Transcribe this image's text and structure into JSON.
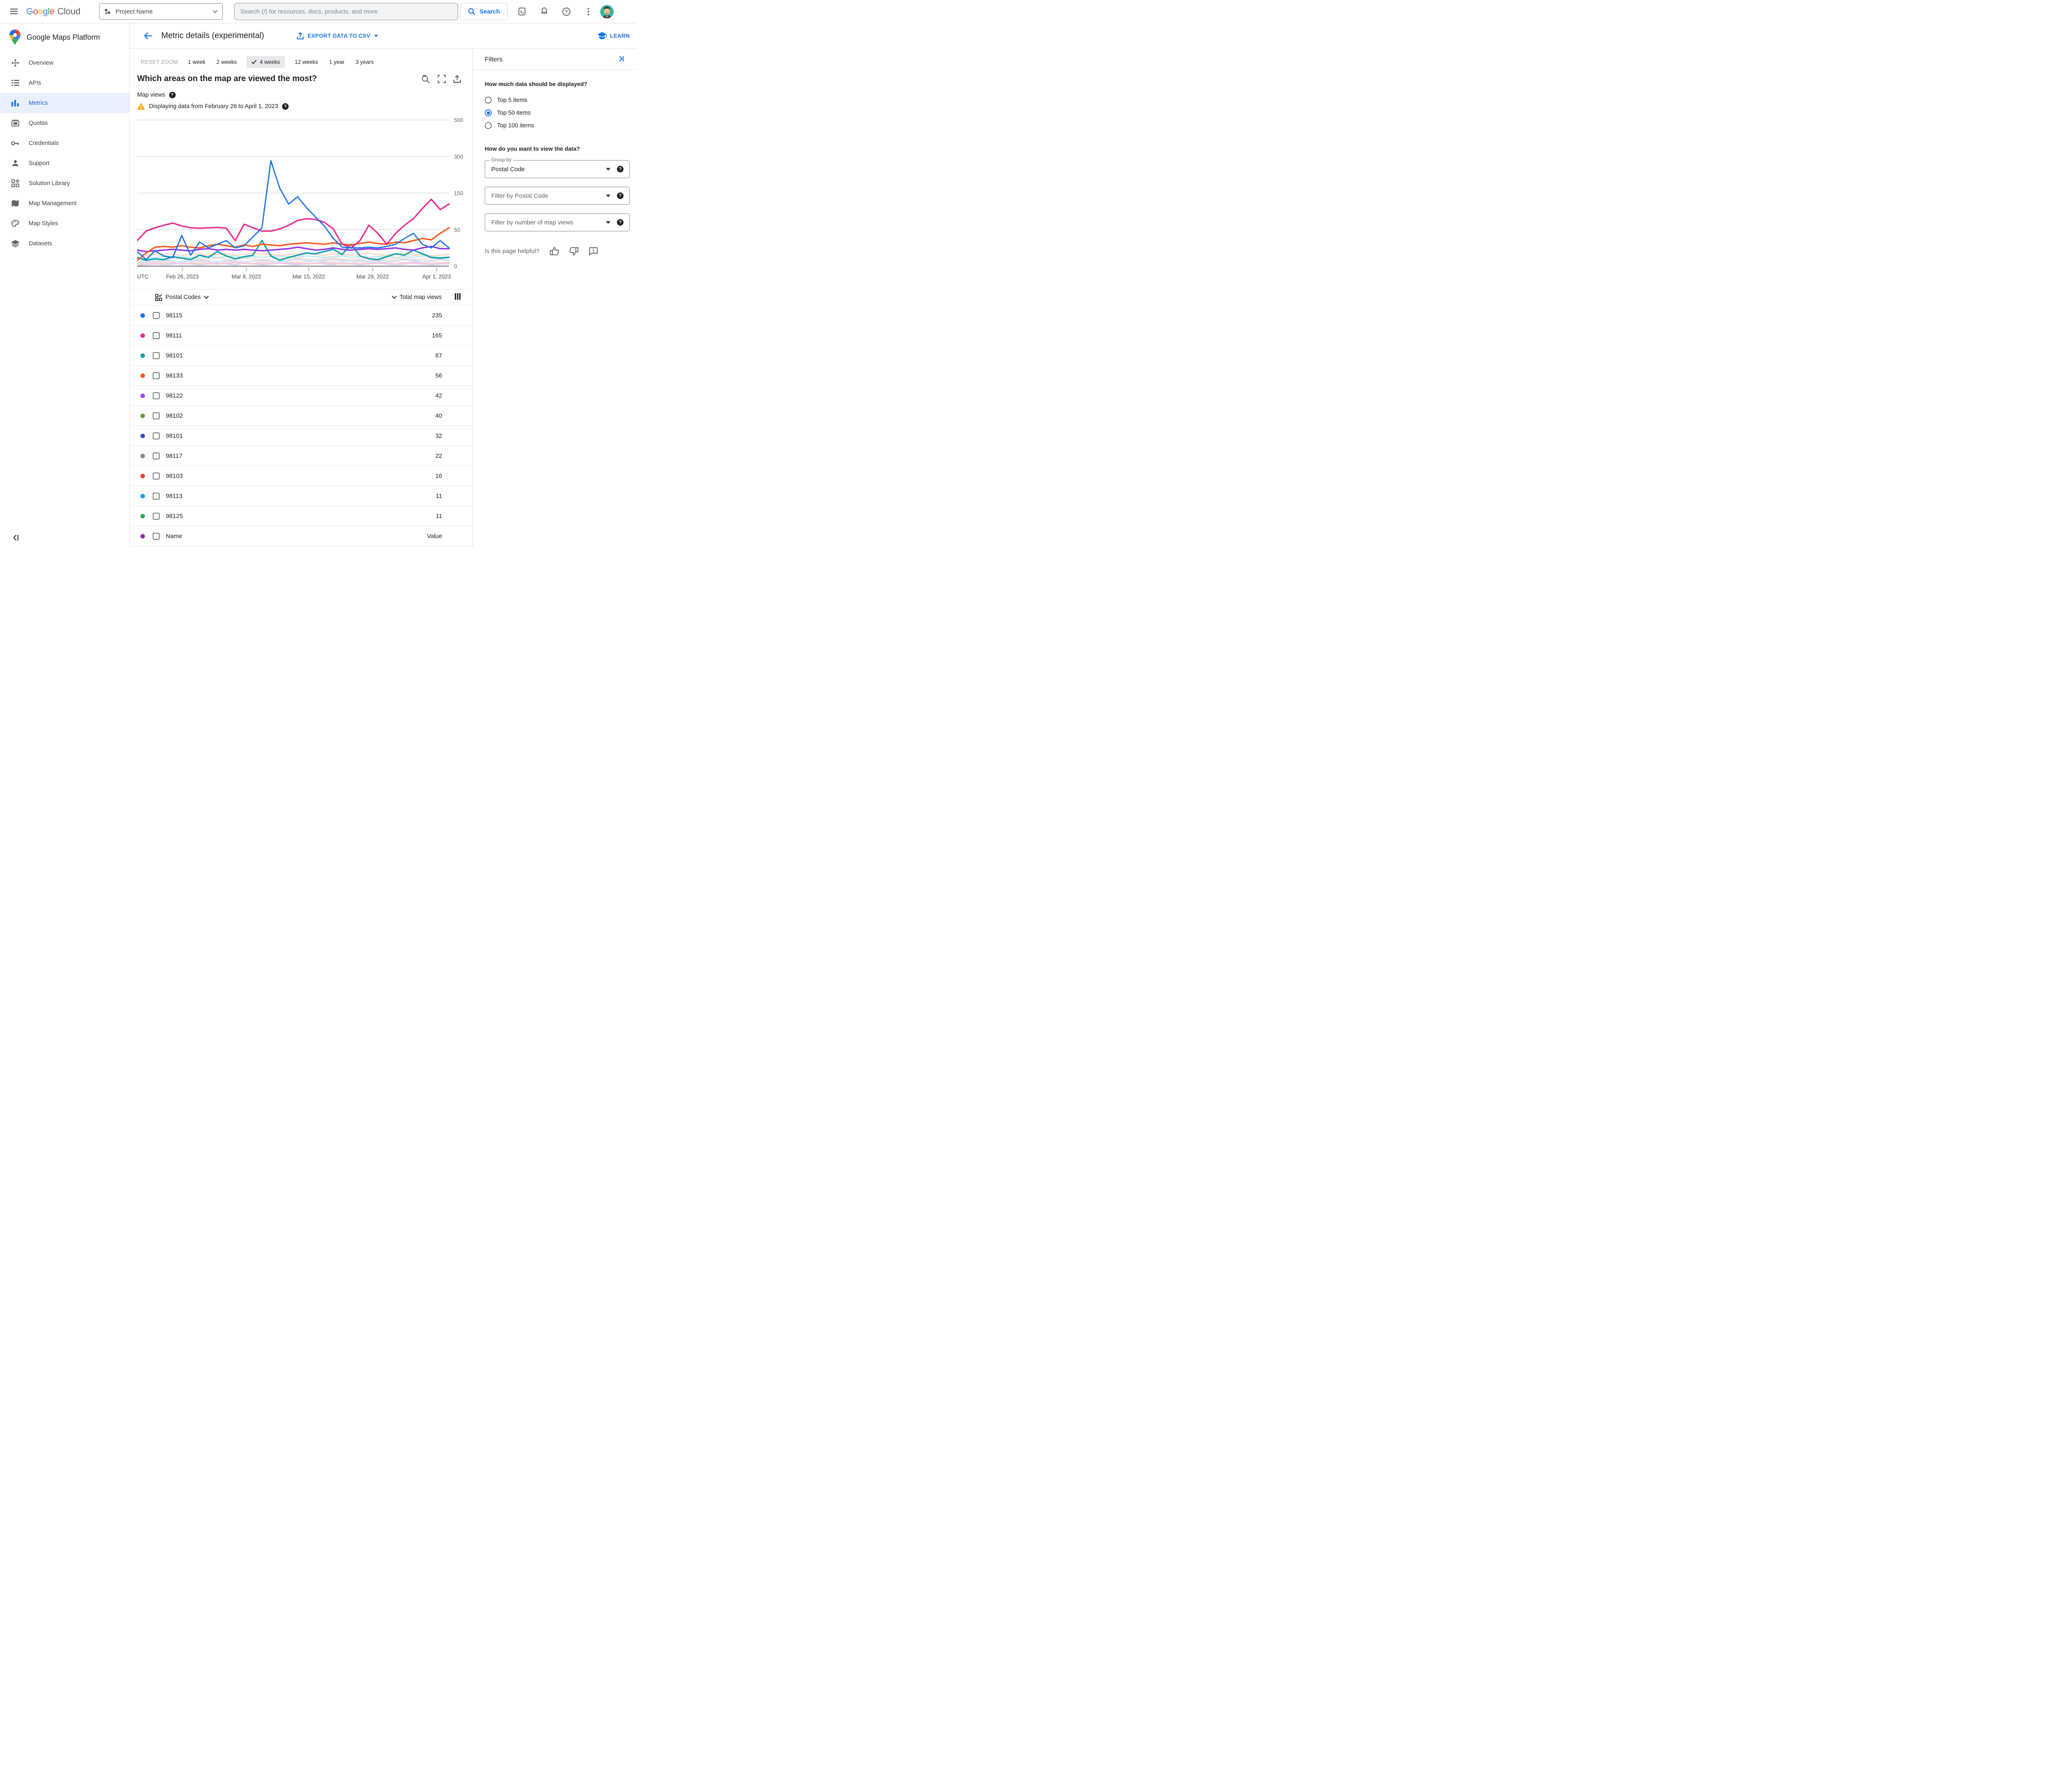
{
  "topbar": {
    "logo_letters": [
      {
        "ch": "G",
        "color": "#4285F4"
      },
      {
        "ch": "o",
        "color": "#EA4335"
      },
      {
        "ch": "o",
        "color": "#FBBC04"
      },
      {
        "ch": "g",
        "color": "#4285F4"
      },
      {
        "ch": "l",
        "color": "#34A853"
      },
      {
        "ch": "e",
        "color": "#EA4335"
      }
    ],
    "logo_suffix": "Cloud",
    "project_name": "Project Name",
    "search_placeholder": "Search (/) for resources, docs, products, and more",
    "search_button": "Search"
  },
  "sidebar": {
    "product_title": "Google Maps Platform",
    "items": [
      {
        "label": "Overview",
        "icon": "overview-icon",
        "active": false
      },
      {
        "label": "APIs",
        "icon": "apis-icon",
        "active": false
      },
      {
        "label": "Metrics",
        "icon": "metrics-icon",
        "active": true
      },
      {
        "label": "Quotas",
        "icon": "quotas-icon",
        "active": false
      },
      {
        "label": "Credentials",
        "icon": "credentials-icon",
        "active": false
      },
      {
        "label": "Support",
        "icon": "support-icon",
        "active": false
      },
      {
        "label": "Solution Library",
        "icon": "solution-library-icon",
        "active": false
      },
      {
        "label": "Map Management",
        "icon": "map-management-icon",
        "active": false
      },
      {
        "label": "Map Styles",
        "icon": "map-styles-icon",
        "active": false
      },
      {
        "label": "Datasets",
        "icon": "datasets-icon",
        "active": false
      }
    ]
  },
  "header": {
    "title": "Metric details (experimental)",
    "export_label": "EXPORT DATA TO CSV",
    "learn_label": "LEARN"
  },
  "time_ranges": {
    "reset_label": "RESET ZOOM",
    "options": [
      "1 week",
      "2 weeks",
      "4 weeks",
      "12 weeks",
      "1 year",
      "3 years"
    ],
    "selected": "4 weeks"
  },
  "chart": {
    "title": "Which areas on the map are viewed the most?",
    "metric_label": "Map views",
    "warning": "Displaying data from February 26 to April 1, 2023"
  },
  "chart_data": {
    "type": "line",
    "title": "Which areas on the map are viewed the most?",
    "ylabel": "Map views",
    "x_axis": {
      "corner_label": "UTC",
      "tick_labels": [
        "Feb 26, 2023",
        "Mar 8, 2022",
        "Mar 15, 2022",
        "Mar 29, 2022",
        "Apr 1, 2023"
      ],
      "tick_fractions": [
        0.145,
        0.35,
        0.55,
        0.755,
        0.96
      ]
    },
    "y_axis": {
      "ticks": [
        0,
        50,
        150,
        300,
        500
      ],
      "scale": "piecewise-equal-segments",
      "grid": true
    },
    "legend_position": "none",
    "series": [
      {
        "name": "unlabeled-a",
        "color": "#fbd7c8",
        "width": 3,
        "values": [
          3,
          14,
          16,
          17,
          16,
          15,
          17,
          16,
          15,
          16,
          17,
          15,
          16,
          18,
          17,
          16,
          15,
          16,
          17,
          18,
          16,
          15,
          17,
          16,
          15,
          17,
          18,
          16,
          15,
          16,
          17,
          15,
          16,
          14,
          15,
          16
        ]
      },
      {
        "name": "unlabeled-b",
        "color": "#bce7ee",
        "width": 3,
        "values": [
          2,
          10,
          12,
          13,
          12,
          13,
          12,
          11,
          13,
          12,
          13,
          14,
          12,
          13,
          12,
          13,
          14,
          13,
          12,
          14,
          13,
          12,
          13,
          14,
          12,
          13,
          12,
          13,
          14,
          12,
          13,
          12,
          14,
          13,
          12,
          13
        ]
      },
      {
        "name": "unlabeled-c",
        "color": "#fcdccd",
        "width": 3,
        "values": [
          2,
          8,
          10,
          9,
          10,
          11,
          10,
          9,
          10,
          11,
          10,
          9,
          11,
          10,
          9,
          10,
          11,
          10,
          11,
          10,
          9,
          10,
          11,
          10,
          9,
          10,
          11,
          9,
          10,
          11,
          10,
          9,
          10,
          11,
          10,
          12
        ]
      },
      {
        "name": "unlabeled-d",
        "color": "#c9d6f8",
        "width": 3,
        "values": [
          1,
          6,
          7,
          8,
          7,
          6,
          7,
          8,
          7,
          6,
          8,
          7,
          6,
          7,
          8,
          7,
          6,
          8,
          9,
          8,
          7,
          8,
          9,
          8,
          7,
          8,
          7,
          8,
          7,
          8,
          9,
          8,
          7,
          8,
          9,
          8
        ]
      },
      {
        "name": "unlabeled-e",
        "color": "#cdeef4",
        "width": 3,
        "values": [
          1,
          5,
          6,
          5,
          6,
          7,
          6,
          5,
          6,
          7,
          6,
          5,
          6,
          7,
          6,
          5,
          7,
          6,
          5,
          6,
          7,
          6,
          5,
          6,
          7,
          6,
          5,
          6,
          7,
          6,
          5,
          6,
          7,
          6,
          5,
          6
        ]
      },
      {
        "name": "unlabeled-f",
        "color": "#fce3d8",
        "width": 3,
        "values": [
          1,
          4,
          5,
          6,
          5,
          4,
          5,
          6,
          5,
          4,
          5,
          6,
          5,
          4,
          6,
          5,
          4,
          5,
          6,
          5,
          4,
          5,
          6,
          5,
          4,
          6,
          5,
          4,
          5,
          6,
          5,
          4,
          5,
          6,
          5,
          5
        ]
      },
      {
        "name": "unlabeled-g",
        "color": "#c9cfee",
        "width": 3,
        "values": [
          1,
          2,
          3,
          2,
          3,
          4,
          3,
          2,
          3,
          4,
          3,
          2,
          4,
          3,
          2,
          3,
          4,
          3,
          2,
          3,
          4,
          3,
          2,
          4,
          3,
          2,
          3,
          4,
          3,
          2,
          3,
          4,
          3,
          2,
          3,
          3
        ]
      },
      {
        "name": "unlabeled-h",
        "color": "#f8c9e0",
        "width": 4,
        "values": [
          1,
          3,
          4,
          3,
          4,
          3,
          4,
          3,
          4,
          3,
          4,
          5,
          4,
          3,
          4,
          3,
          4,
          5,
          4,
          3,
          4,
          5,
          4,
          3,
          4,
          3,
          4,
          5,
          4,
          3,
          4,
          5,
          4,
          3,
          4,
          4
        ]
      },
      {
        "name": "98101",
        "color": "#10a2ad",
        "width": 3.5,
        "values": [
          12,
          8,
          10,
          9,
          13,
          11,
          9,
          15,
          12,
          20,
          14,
          10,
          13,
          15,
          35,
          14,
          8,
          12,
          15,
          18,
          17,
          20,
          23,
          16,
          30,
          14,
          10,
          9,
          13,
          17,
          15,
          22,
          17,
          12,
          11,
          12
        ]
      },
      {
        "name": "98122",
        "color": "#9334e6",
        "width": 3.5,
        "values": [
          22,
          20,
          21,
          22,
          23,
          22,
          21,
          23,
          24,
          22,
          23,
          22,
          23,
          22,
          21,
          22,
          23,
          24,
          26,
          24,
          22,
          23,
          25,
          23,
          22,
          23,
          24,
          23,
          24,
          25,
          23,
          22,
          25,
          27,
          24,
          24
        ]
      },
      {
        "name": "98133",
        "color": "#f85b1d",
        "width": 3.5,
        "values": [
          8,
          18,
          26,
          27,
          26,
          28,
          26,
          25,
          28,
          30,
          28,
          26,
          29,
          27,
          30,
          29,
          28,
          30,
          31,
          32,
          31,
          30,
          32,
          30,
          29,
          31,
          33,
          31,
          30,
          33,
          32,
          35,
          38,
          36,
          45,
          55
        ]
      },
      {
        "name": "98111",
        "color": "#ea2e90",
        "width": 3.5,
        "values": [
          35,
          48,
          55,
          62,
          68,
          60,
          55,
          54,
          55,
          56,
          54,
          35,
          65,
          55,
          48,
          48,
          52,
          62,
          75,
          80,
          78,
          70,
          52,
          30,
          25,
          35,
          62,
          45,
          30,
          45,
          62,
          80,
          108,
          133,
          105,
          120
        ]
      },
      {
        "name": "98115",
        "color": "#1a73e8",
        "width": 3,
        "values": [
          20,
          9,
          21,
          14,
          12,
          42,
          15,
          33,
          25,
          30,
          35,
          25,
          28,
          40,
          55,
          283,
          170,
          120,
          140,
          110,
          85,
          60,
          38,
          26,
          25,
          25,
          26,
          25,
          27,
          30,
          38,
          45,
          30,
          25,
          35,
          25
        ]
      }
    ]
  },
  "table": {
    "group_header": "Postal Codes",
    "value_header": "Total map views",
    "rows": [
      {
        "code": "98115",
        "value": "235",
        "color": "#1a73e8"
      },
      {
        "code": "98111",
        "value": "165",
        "color": "#ea2e90"
      },
      {
        "code": "98101",
        "value": "67",
        "color": "#10a2ad"
      },
      {
        "code": "98133",
        "value": "56",
        "color": "#f85b1d"
      },
      {
        "code": "98122",
        "value": "42",
        "color": "#a142f4"
      },
      {
        "code": "98102",
        "value": "40",
        "color": "#689f38"
      },
      {
        "code": "98101",
        "value": "32",
        "color": "#3f51b5"
      },
      {
        "code": "98117",
        "value": "22",
        "color": "#80868b"
      },
      {
        "code": "98103",
        "value": "16",
        "color": "#ea4335"
      },
      {
        "code": "98113",
        "value": "11",
        "color": "#09a2f5"
      },
      {
        "code": "98125",
        "value": "11",
        "color": "#34a853"
      },
      {
        "code": "Name",
        "value": "Value",
        "color": "#9c27b0"
      }
    ]
  },
  "filters": {
    "title": "Filters",
    "question1": "How much data should be displayed?",
    "radios": [
      {
        "label": "Top 5 items",
        "selected": false
      },
      {
        "label": "Top 50 items",
        "selected": true
      },
      {
        "label": "Top 100 items",
        "selected": false
      }
    ],
    "question2": "How do you want to view the data?",
    "group_by_label": "Group by",
    "group_by_value": "Postal Code",
    "filter_postal_placeholder": "Filter by Postal Code",
    "filter_views_placeholder": "Filter by number of map views",
    "helpful_label": "Is this page helpful?"
  }
}
